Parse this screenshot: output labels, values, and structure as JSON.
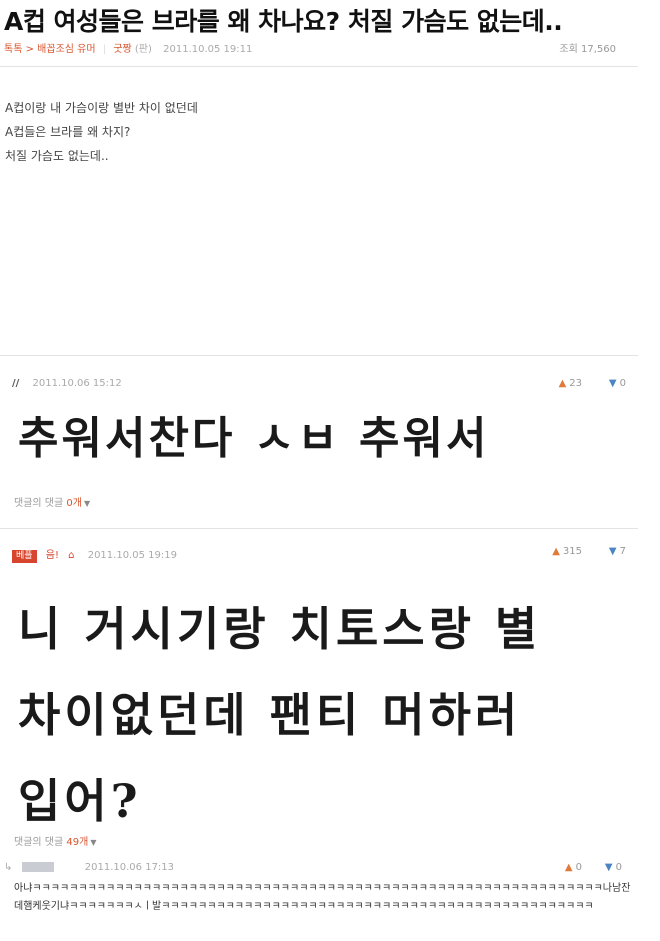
{
  "post": {
    "title": "A컵 여성들은 브라를 왜 차나요? 처질 가슴도 없는데..",
    "breadcrumb_board": "톡톡",
    "breadcrumb_sep": ">",
    "breadcrumb_category": "배꼽조심 유머",
    "author": "굿짱",
    "author_tag": "(판)",
    "date": "2011.10.05 19:11",
    "views_label": "조회 17,560",
    "body_lines": [
      "A컵이랑 내 가슴이랑 별반 차이 없던데",
      "A컵들은 브라를 왜 차지?",
      "처질 가슴도 없는데.."
    ]
  },
  "comments": [
    {
      "author": "//",
      "date": "2011.10.06 15:12",
      "up_count": "23",
      "down_count": "0",
      "text": "추워서찬다 ㅅㅂ 추워서",
      "replies_label": "댓글의 댓글",
      "replies_count": "0개"
    },
    {
      "badge": "베플",
      "author": "음!",
      "date": "2011.10.05 19:19",
      "up_count": "315",
      "down_count": "7",
      "text_lines": [
        "니 거시기랑 치토스랑 별",
        "차이없던데   팬티 머하러",
        "입어?"
      ],
      "replies_label": "댓글의 댓글",
      "replies_count": "49개"
    }
  ],
  "sub_comment": {
    "date": "2011.10.06 17:13",
    "up_count": "0",
    "down_count": "0",
    "text": "아냐ㅋㅋㅋㅋㅋㅋㅋㅋㅋㅋㅋㅋㅋㅋㅋㅋㅋㅋㅋㅋㅋㅋㅋㅋㅋㅋㅋㅋㅋㅋㅋㅋㅋㅋㅋㅋㅋㅋㅋㅋㅋㅋㅋㅋㅋㅋㅋㅋㅋㅋㅋㅋㅋㅋㅋㅋㅋㅋㅋㅋㅋㅋ나남잔데햄케웃기냐ㅋㅋㅋㅋㅋㅋㅋㅅㅣ발ㅋㅋㅋㅋㅋㅋㅋㅋㅋㅋㅋㅋㅋㅋㅋㅋㅋㅋㅋㅋㅋㅋㅋㅋㅋㅋㅋㅋㅋㅋㅋㅋㅋㅋㅋㅋㅋㅋㅋㅋㅋㅋㅋㅋㅋㅋㅋ"
  },
  "icons": {
    "thumb_up": "thumb-up-icon",
    "thumb_down": "thumb-down-icon",
    "home": "home-icon",
    "reply_arrow": "reply-arrow-icon",
    "dropdown": "caret-down-icon"
  },
  "colors": {
    "accent": "#d8552f",
    "badge": "#d8452f",
    "up": "#e07a3a",
    "down": "#4b84c3"
  }
}
